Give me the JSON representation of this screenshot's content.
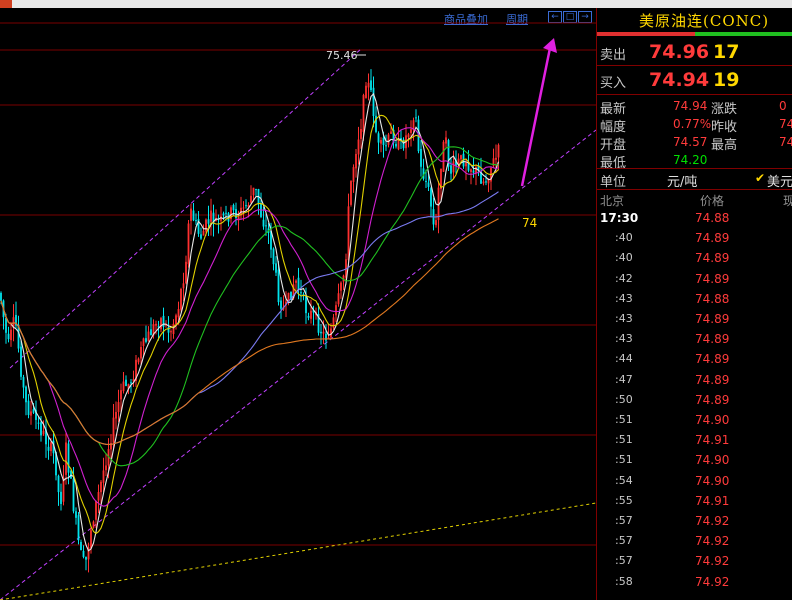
{
  "toolbar": {
    "overlay_label": "商品叠加",
    "period_label": "周期",
    "nav_buttons": [
      "←",
      "□",
      "→"
    ]
  },
  "chart_data": {
    "type": "candlestick",
    "price_labels": {
      "peak": "75.46",
      "annotation": "74"
    },
    "colors": {
      "up": "#ff3030",
      "down": "#00e5ee",
      "ma1": "#e8e8e8",
      "ma2": "#e0d000",
      "ma3": "#d020d0",
      "ma4": "#20c020",
      "ma5": "#7a7af0",
      "ma6": "#e07820",
      "channel": "#c040ff",
      "arrow": "#e020e0"
    }
  },
  "panel": {
    "title": "美原油连(CONC)",
    "sell_label": "卖出",
    "sell_price": "74.96",
    "sell_vol": "17",
    "buy_label": "买入",
    "buy_price": "74.94",
    "buy_vol": "19",
    "stats": [
      {
        "label": "最新",
        "value": "74.94",
        "label2": "涨跌",
        "value2": "0"
      },
      {
        "label": "幅度",
        "value": "0.77%",
        "label2": "昨收",
        "value2": "74"
      },
      {
        "label": "开盘",
        "value": "74.57",
        "label2": "最高",
        "value2": "74"
      },
      {
        "label": "最低",
        "value": "74.20",
        "label2": "",
        "value2": ""
      }
    ],
    "unit_label": "单位",
    "unit_value": "元/吨",
    "currency": "美元",
    "tick_headers": {
      "time": "北京",
      "price": "价格",
      "vol": "现"
    },
    "ticks": [
      {
        "time": "17:30",
        "price": "74.88"
      },
      {
        "time": ":40",
        "price": "74.89"
      },
      {
        "time": ":40",
        "price": "74.89"
      },
      {
        "time": ":42",
        "price": "74.89"
      },
      {
        "time": ":43",
        "price": "74.88"
      },
      {
        "time": ":43",
        "price": "74.89"
      },
      {
        "time": ":43",
        "price": "74.89"
      },
      {
        "time": ":44",
        "price": "74.89"
      },
      {
        "time": ":47",
        "price": "74.89"
      },
      {
        "time": ":50",
        "price": "74.89"
      },
      {
        "time": ":51",
        "price": "74.90"
      },
      {
        "time": ":51",
        "price": "74.91"
      },
      {
        "time": ":51",
        "price": "74.90"
      },
      {
        "time": ":54",
        "price": "74.90"
      },
      {
        "time": ":55",
        "price": "74.91"
      },
      {
        "time": ":57",
        "price": "74.92"
      },
      {
        "time": ":57",
        "price": "74.92"
      },
      {
        "time": ":57",
        "price": "74.92"
      },
      {
        "time": ":58",
        "price": "74.92"
      }
    ]
  }
}
